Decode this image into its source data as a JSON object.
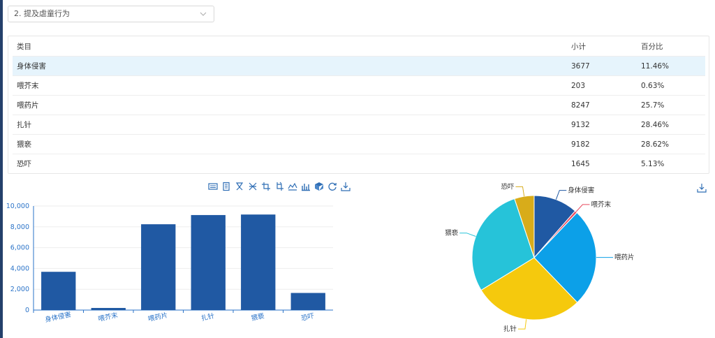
{
  "dropdown": {
    "selected": "2. 提及虐童行为"
  },
  "table": {
    "headers": [
      "类目",
      "小计",
      "百分比"
    ],
    "rows": [
      [
        "身体侵害",
        "3677",
        "11.46%"
      ],
      [
        "喂芥末",
        "203",
        "0.63%"
      ],
      [
        "喂药片",
        "8247",
        "25.7%"
      ],
      [
        "扎针",
        "9132",
        "28.46%"
      ],
      [
        "猥亵",
        "9182",
        "28.62%"
      ],
      [
        "恐吓",
        "1645",
        "5.13%"
      ]
    ]
  },
  "toolbar_icons": [
    "data-view-icon",
    "text-icon",
    "lasso-icon",
    "scissors-icon",
    "crop-icon",
    "crop-alt-icon",
    "line-chart-icon",
    "bar-chart-icon",
    "box-icon",
    "refresh-icon",
    "download-icon"
  ],
  "chart_data": [
    {
      "type": "bar",
      "categories": [
        "身体侵害",
        "喂芥末",
        "喂药片",
        "扎针",
        "猥亵",
        "恐吓"
      ],
      "values": [
        3677,
        203,
        8247,
        9132,
        9182,
        1645
      ],
      "ylim": [
        0,
        10000
      ],
      "yticks": [
        "0",
        "2,000",
        "4,000",
        "6,000",
        "8,000",
        "10,000"
      ],
      "color": "#2059a3"
    },
    {
      "type": "pie",
      "labels": [
        "身体侵害",
        "喂芥末",
        "喂药片",
        "扎针",
        "猥亵",
        "恐吓"
      ],
      "values": [
        3677,
        203,
        8247,
        9132,
        9182,
        1645
      ],
      "colors": [
        "#2059a3",
        "#e84a5f",
        "#0ca0e8",
        "#f5c90d",
        "#26c3d9",
        "#d8ac1a"
      ]
    }
  ]
}
